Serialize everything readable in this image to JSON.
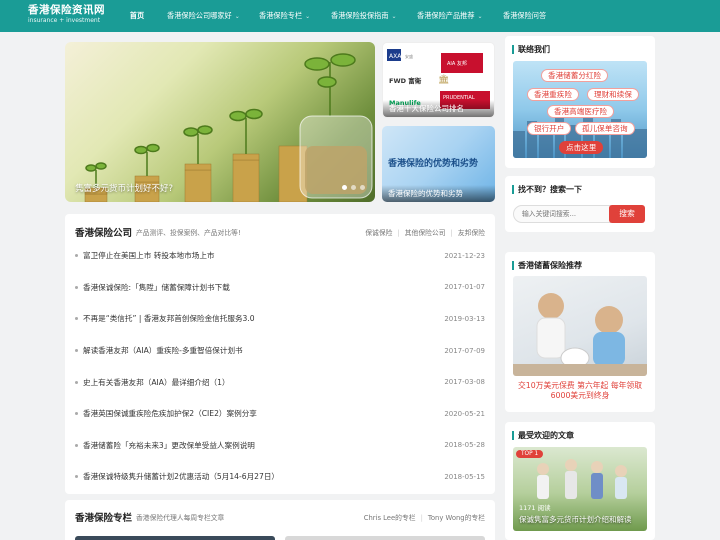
{
  "site": {
    "logo_main": "香港保险资讯网",
    "logo_sub": "insurance + investment"
  },
  "nav": {
    "items": [
      {
        "label": "首页",
        "has_dropdown": false,
        "active": true
      },
      {
        "label": "香港保险公司哪家好",
        "has_dropdown": true
      },
      {
        "label": "香港保险专栏",
        "has_dropdown": true
      },
      {
        "label": "香港保险投保指南",
        "has_dropdown": true
      },
      {
        "label": "香港保险产品推荐",
        "has_dropdown": true
      },
      {
        "label": "香港保险问答",
        "has_dropdown": false
      }
    ],
    "dropdown_icon": "chevron-down-icon"
  },
  "hero": {
    "caption": "隽富多元货币计划好不好?"
  },
  "side_cards": [
    {
      "caption": "香港十大保险公司排名",
      "logos": [
        "AIA",
        "FWD富衛",
        "Manulife",
        "PRUDENTIAL"
      ]
    },
    {
      "caption": "香港保险的优势和劣势",
      "title": "香港保险的优势和劣势"
    }
  ],
  "company_section": {
    "title": "香港保险公司",
    "subtitle": "产品测评、投保案例、产品对比等!",
    "tags": [
      "保诚保险",
      "其他保险公司",
      "友邦保险"
    ],
    "items": [
      {
        "title": "富卫停止在美国上市 转投本地市场上市",
        "date": "2021-12-23"
      },
      {
        "title": "香港保诚保险:「雋陞」储蓄保障计划书下载",
        "date": "2017-01-07"
      },
      {
        "title": "不再是“类信托” | 香港友邦首创保险金信托服务3.0",
        "date": "2019-03-13"
      },
      {
        "title": "解读香港友邦（AIA）重疾险-多重智倍保计划书",
        "date": "2017-07-09"
      },
      {
        "title": "史上有关香港友邦（AIA）最详细介绍（1）",
        "date": "2017-03-08"
      },
      {
        "title": "香港英国保诚重疾险危疾加护保2（CIE2）案例分享",
        "date": "2020-05-21"
      },
      {
        "title": "香港储蓄险「充裕未来3」更改保单受益人案例说明",
        "date": "2018-05-28"
      },
      {
        "title": "香港保诚特级隽升储蓄计划2优惠活动（5月14-6月27日）",
        "date": "2018-05-15"
      }
    ]
  },
  "column_section": {
    "title": "香港保险专栏",
    "subtitle": "香港保险代理人每周专栏文章",
    "tags": [
      "Chris Lee的专栏",
      "Tony Wong的专栏"
    ]
  },
  "sidebar": {
    "contact": {
      "title": "联络我们",
      "pills": [
        "香港储蓄分红险",
        "香港重疾险",
        "理财和续保",
        "香港高端医疗险",
        "银行开户",
        "孤儿保单咨询"
      ],
      "cta": "点击这里"
    },
    "search": {
      "title": "找不到？搜索一下",
      "placeholder": "输入关键词搜索...",
      "button": "搜索"
    },
    "savings": {
      "title": "香港储蓄保险推荐",
      "caption": "交10万美元保费 第六年起 每年领取6000美元到终身"
    },
    "popular": {
      "title": "最受欢迎的文章",
      "badge": "TOP 1",
      "views": "1171 阅读",
      "caption": "保诚隽富多元货币计划介绍和解读"
    }
  },
  "colors": {
    "brand": "#1a9c96",
    "accent": "#e0413a"
  }
}
